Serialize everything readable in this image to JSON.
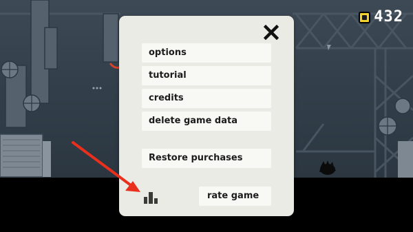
{
  "hud": {
    "coin_count": "432",
    "coin_icon": "coin-icon",
    "coin_color": "#f3d22e"
  },
  "menu": {
    "close_label": "X",
    "items": [
      {
        "label": "options"
      },
      {
        "label": "tutorial"
      },
      {
        "label": "credits"
      },
      {
        "label": "delete game data"
      }
    ],
    "restore_label": "Restore purchases",
    "rate_label": "rate game",
    "leaderboard_icon": "leaderboard-icon",
    "panel_color": "#ebebe6",
    "button_color": "#f8f8f5"
  },
  "annotation": {
    "arrow_color": "#e8301c",
    "target": "leaderboard-button"
  }
}
